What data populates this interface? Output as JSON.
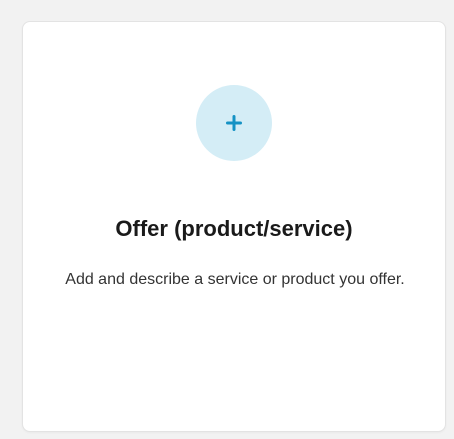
{
  "card": {
    "title": "Offer (product/service)",
    "description": "Add and describe a service or product you offer.",
    "icon": "plus-icon"
  },
  "colors": {
    "page_background": "#f2f2f2",
    "card_background": "#ffffff",
    "icon_circle": "#d4edf6",
    "icon_plus": "#1592c4",
    "title_text": "#1a1a1a",
    "body_text": "#333333"
  }
}
